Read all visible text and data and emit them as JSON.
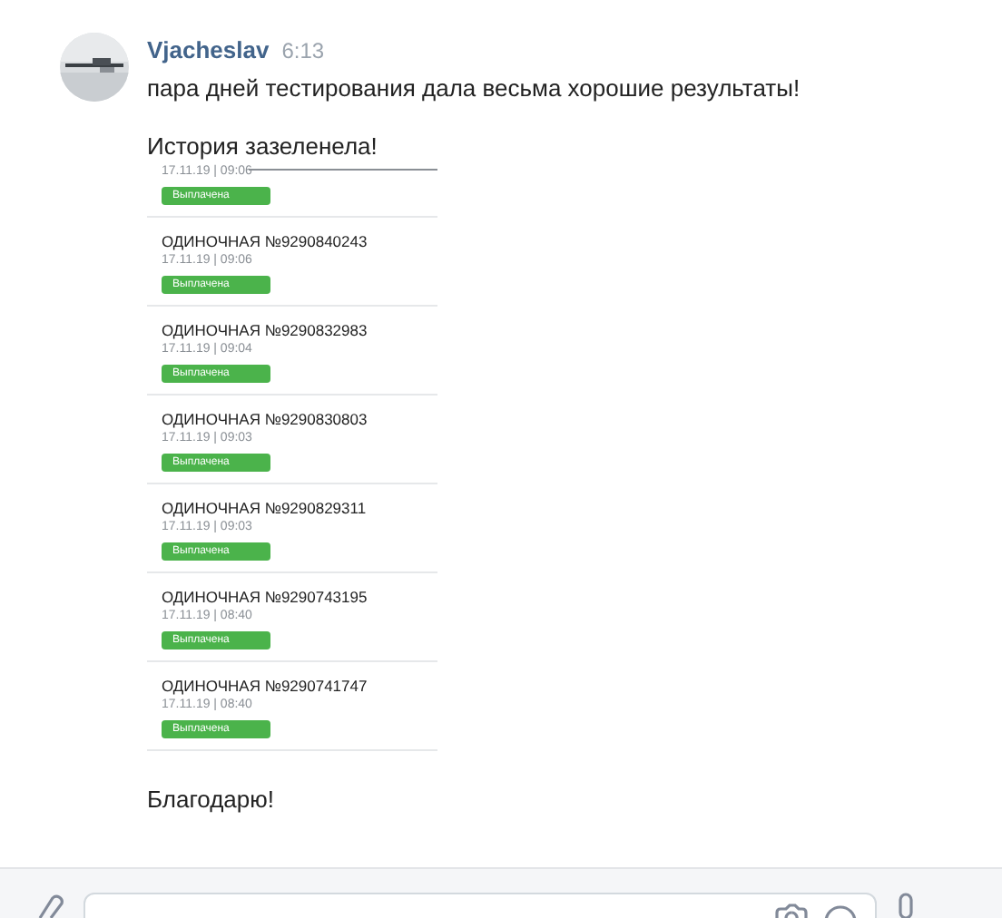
{
  "message": {
    "author": "Vjacheslav",
    "time": "6:13",
    "lines": [
      "пара дней тестирования дала весьма хорошие результаты!",
      "История зазеленела!"
    ],
    "attachment": {
      "top_item": {
        "date": "17.11.19 | 09:06",
        "status": "Выплачена"
      },
      "items": [
        {
          "title": "ОДИНОЧНАЯ №9290840243",
          "date": "17.11.19 | 09:06",
          "status": "Выплачена"
        },
        {
          "title": "ОДИНОЧНАЯ №9290832983",
          "date": "17.11.19 | 09:04",
          "status": "Выплачена"
        },
        {
          "title": "ОДИНОЧНАЯ №9290830803",
          "date": "17.11.19 | 09:03",
          "status": "Выплачена"
        },
        {
          "title": "ОДИНОЧНАЯ №9290829311",
          "date": "17.11.19 | 09:03",
          "status": "Выплачена"
        },
        {
          "title": "ОДИНОЧНАЯ №9290743195",
          "date": "17.11.19 | 08:40",
          "status": "Выплачена"
        },
        {
          "title": "ОДИНОЧНАЯ №9290741747",
          "date": "17.11.19 | 08:40",
          "status": "Выплачена"
        }
      ]
    },
    "closing": "Благодарю!"
  }
}
